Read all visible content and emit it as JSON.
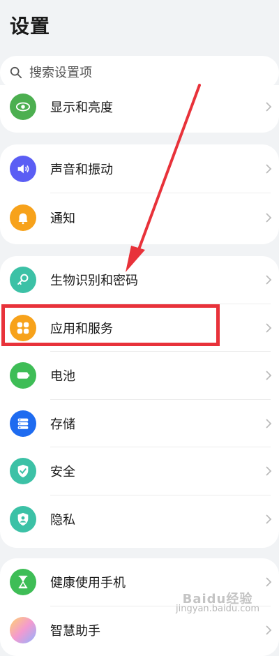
{
  "header": {
    "title": "设置"
  },
  "search": {
    "placeholder": "搜索设置项"
  },
  "groups": [
    {
      "items": [
        {
          "label": "显示和亮度",
          "icon": "eye-icon",
          "color": "#4caf50"
        }
      ]
    },
    {
      "items": [
        {
          "label": "声音和振动",
          "icon": "speaker-icon",
          "color": "#5b5ef4"
        },
        {
          "label": "通知",
          "icon": "bell-icon",
          "color": "#f7a21b"
        }
      ]
    },
    {
      "items": [
        {
          "label": "生物识别和密码",
          "icon": "key-icon",
          "color": "#3cc1a6"
        },
        {
          "label": "应用和服务",
          "icon": "apps-grid-icon",
          "color": "#f7a21b"
        },
        {
          "label": "电池",
          "icon": "battery-icon",
          "color": "#3ebd56"
        },
        {
          "label": "存储",
          "icon": "storage-icon",
          "color": "#1e6bf0"
        },
        {
          "label": "安全",
          "icon": "shield-check-icon",
          "color": "#3cc1a6"
        },
        {
          "label": "隐私",
          "icon": "privacy-shield-icon",
          "color": "#3cc1a6"
        }
      ]
    },
    {
      "items": [
        {
          "label": "健康使用手机",
          "icon": "hourglass-icon",
          "color": "#3ebd56"
        },
        {
          "label": "智慧助手",
          "icon": "assistant-icon",
          "color": "#f39ad0"
        }
      ]
    }
  ],
  "annotation": {
    "highlight_color": "#e8323a"
  },
  "watermark": {
    "brand": "Baidu经验",
    "url": "jingyan.baidu.com"
  }
}
